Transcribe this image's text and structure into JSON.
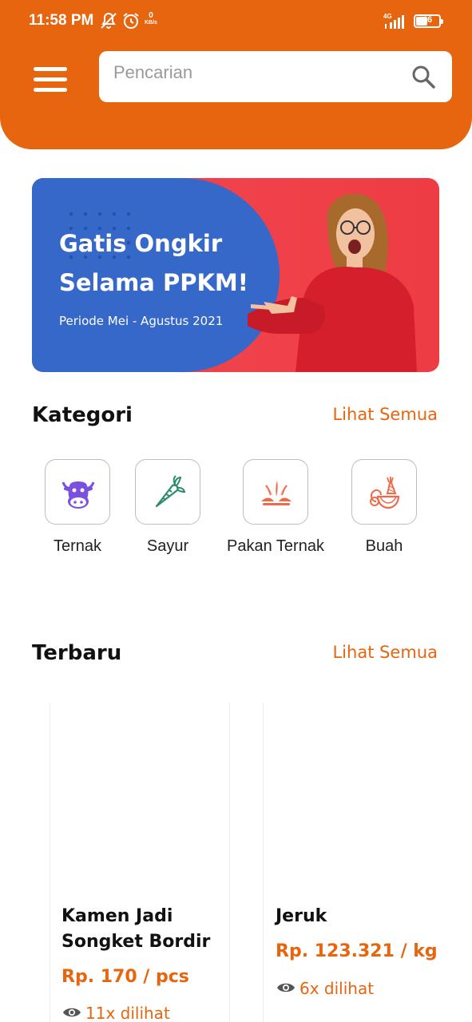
{
  "status_bar": {
    "time": "11:58 PM",
    "speed_value": "0",
    "speed_unit": "KB/s",
    "network": "4G",
    "battery": "46"
  },
  "header": {
    "search": {
      "placeholder": "Pencarian"
    },
    "accent_color": "#E8650F"
  },
  "banner": {
    "title": "Gatis Ongkir Selama PPKM!",
    "subtitle": "Periode Mei - Agustus 2021",
    "colors": {
      "blob": "#3668C9",
      "background": "#EE3C43"
    }
  },
  "categories": {
    "title": "Kategori",
    "see_all": "Lihat Semua",
    "items": [
      {
        "label": "Ternak",
        "icon": "cow-icon"
      },
      {
        "label": "Sayur",
        "icon": "carrot-icon"
      },
      {
        "label": "Pakan Ternak",
        "icon": "grass-icon"
      },
      {
        "label": "Buah",
        "icon": "fruit-basket-icon"
      }
    ]
  },
  "latest": {
    "title": "Terbaru",
    "see_all": "Lihat Semua",
    "products": [
      {
        "name": "Kamen Jadi Songket Bordir",
        "price": "Rp. 170 / pcs",
        "views": "11x dilihat"
      },
      {
        "name": "Jeruk",
        "price": "Rp. 123.321 / kg",
        "views": "6x dilihat"
      }
    ]
  }
}
